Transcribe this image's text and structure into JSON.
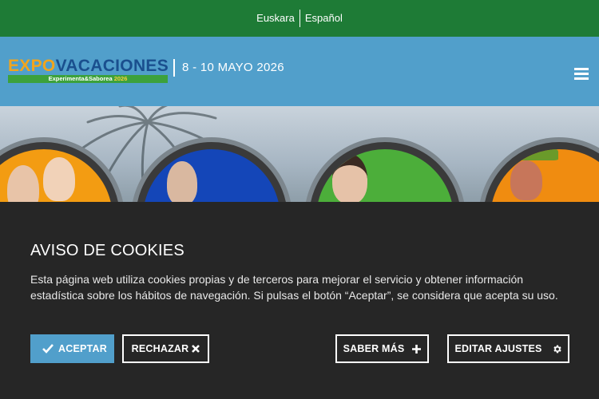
{
  "lang_bar": {
    "items": [
      {
        "label": "Euskara"
      },
      {
        "label": "Español"
      }
    ]
  },
  "header": {
    "logo": {
      "part1": "EXPO",
      "part2": "VACACIONES",
      "tagline": "Experimenta&Saborea",
      "tagline_year": "2026"
    },
    "dates": "8 - 10 MAYO 2026",
    "menu_icon": "hamburger-icon"
  },
  "hero": {
    "circle_colors": [
      "#f39c12",
      "#1446b8",
      "#4cae3a",
      "#f08c10"
    ]
  },
  "cookie_banner": {
    "title": "AVISO DE COOKIES",
    "text": "Esta página web utiliza cookies propias y de terceros para mejorar el servicio y obtener información estadística sobre los hábitos de navegación. Si pulsas el botón “Aceptar”, se considera que acepta su uso.",
    "buttons": {
      "accept": {
        "label": "ACEPTAR",
        "icon": "check-icon"
      },
      "reject": {
        "label": "RECHAZAR",
        "icon": "x-icon"
      },
      "more": {
        "label": "SABER MÁS",
        "icon": "plus-icon"
      },
      "settings": {
        "label": "EDITAR AJUSTES",
        "icon": "gear-icon"
      }
    }
  },
  "colors": {
    "lang_bar_bg": "#1e7b36",
    "header_bg": "#519fcb",
    "cookie_bg": "#262626",
    "accept_bg": "#519fcb"
  }
}
